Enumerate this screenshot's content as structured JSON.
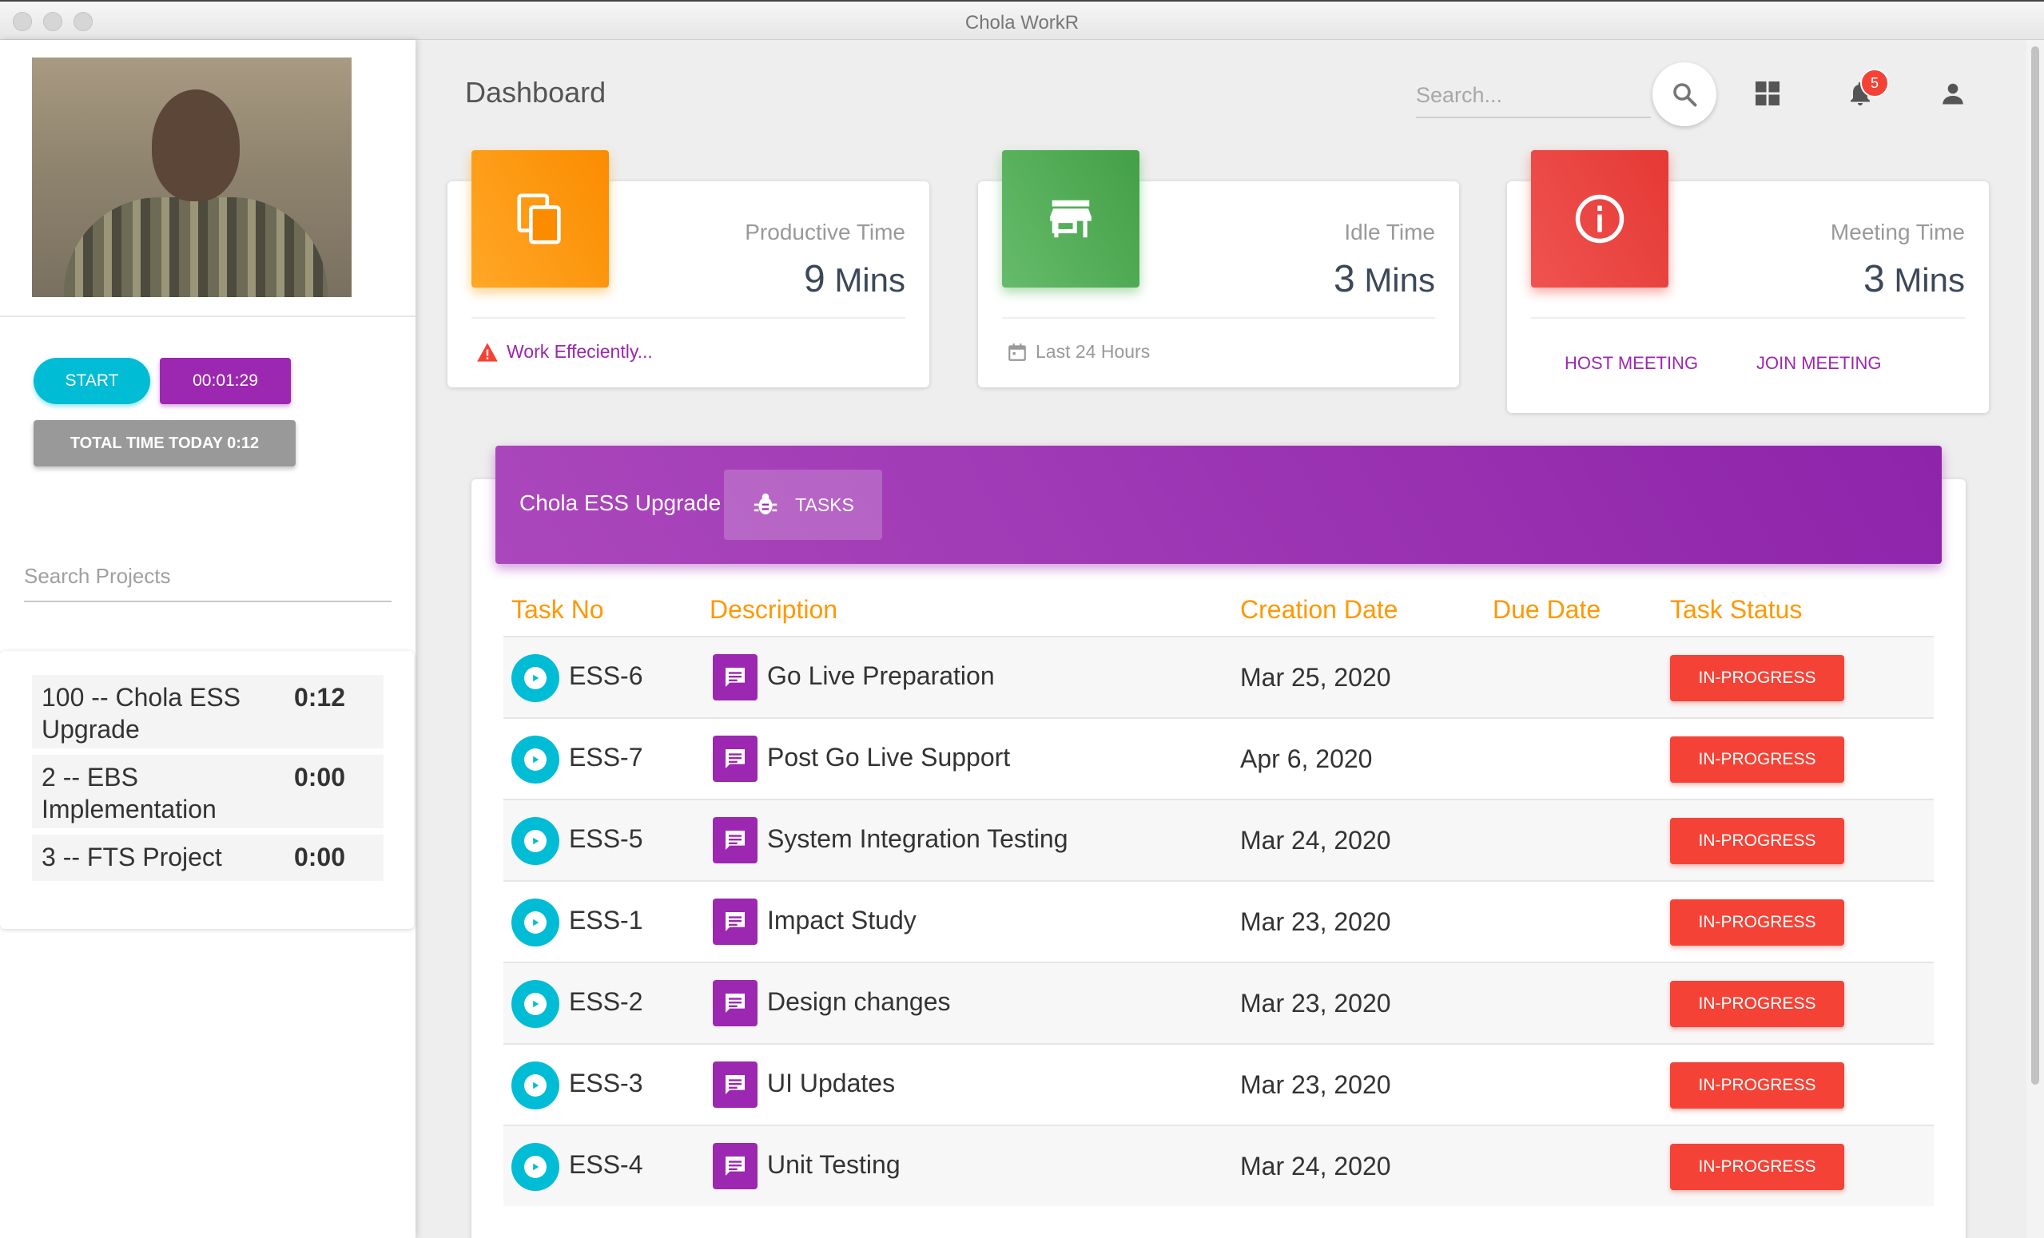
{
  "window": {
    "title": "Chola WorkR"
  },
  "sidebar": {
    "start_label": "START",
    "timer_label": "00:01:29",
    "total_label": "TOTAL TIME TODAY 0:12",
    "search_placeholder": "Search Projects",
    "projects": [
      {
        "name": "100 -- Chola ESS Upgrade",
        "time": "0:12"
      },
      {
        "name": "2 -- EBS Implementation",
        "time": "0:00"
      },
      {
        "name": "3 -- FTS Project",
        "time": "0:00"
      }
    ]
  },
  "header": {
    "title": "Dashboard",
    "search_placeholder": "Search...",
    "notification_count": "5"
  },
  "cards": {
    "productive": {
      "label": "Productive Time",
      "value": "9",
      "unit": "Mins",
      "footer": "Work Effeciently...",
      "color": "#ff9800"
    },
    "idle": {
      "label": "Idle Time",
      "value": "3",
      "unit": "Mins",
      "footer": "Last 24 Hours",
      "color": "#4caf50"
    },
    "meeting": {
      "label": "Meeting Time",
      "value": "3",
      "unit": "Mins",
      "host_label": "HOST MEETING",
      "join_label": "JOIN MEETING",
      "color": "#e53935"
    }
  },
  "tasks": {
    "project_title": "Chola ESS Upgrade",
    "tab_label": "TASKS",
    "columns": [
      "Task No",
      "Description",
      "Creation Date",
      "Due Date",
      "Task Status"
    ],
    "rows": [
      {
        "no": "ESS-6",
        "desc": "Go Live Preparation",
        "created": "Mar 25, 2020",
        "status": "IN-PROGRESS"
      },
      {
        "no": "ESS-7",
        "desc": "Post Go Live Support",
        "created": "Apr 6, 2020",
        "status": "IN-PROGRESS"
      },
      {
        "no": "ESS-5",
        "desc": "System Integration Testing",
        "created": "Mar 24, 2020",
        "status": "IN-PROGRESS"
      },
      {
        "no": "ESS-1",
        "desc": "Impact Study",
        "created": "Mar 23, 2020",
        "status": "IN-PROGRESS"
      },
      {
        "no": "ESS-2",
        "desc": "Design changes",
        "created": "Mar 23, 2020",
        "status": "IN-PROGRESS"
      },
      {
        "no": "ESS-3",
        "desc": "UI Updates",
        "created": "Mar 23, 2020",
        "status": "IN-PROGRESS"
      },
      {
        "no": "ESS-4",
        "desc": "Unit Testing",
        "created": "Mar 24, 2020",
        "status": "IN-PROGRESS"
      }
    ]
  },
  "colors": {
    "accent_purple": "#9c27b0",
    "accent_cyan": "#00bcd4",
    "status_red": "#f44336",
    "header_orange": "#ff9800"
  }
}
